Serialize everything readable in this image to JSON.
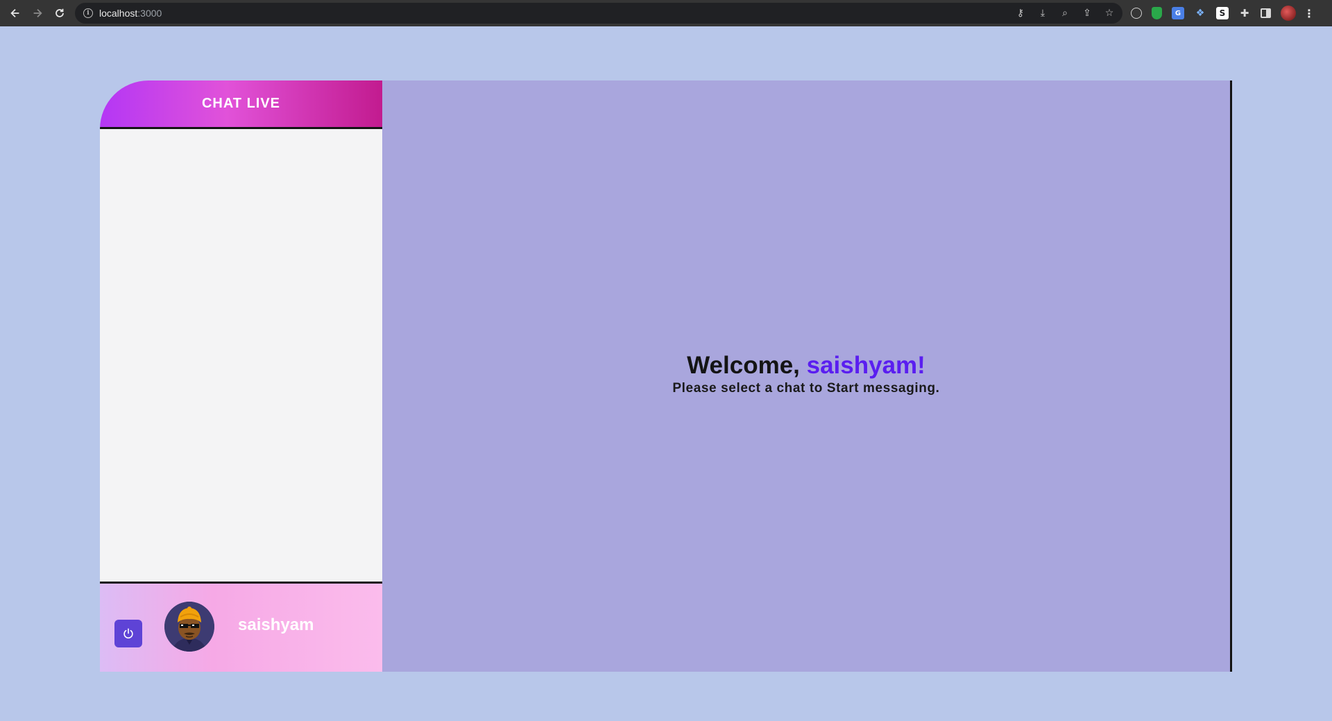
{
  "browser": {
    "url_host": "localhost",
    "url_port": ":3000"
  },
  "sidebar": {
    "title": "CHAT LIVE",
    "chats": []
  },
  "user": {
    "username": "saishyam",
    "avatar_icon": "avatar-icon",
    "logout_icon": "power-icon"
  },
  "main": {
    "welcome_prefix": "Welcome, ",
    "welcome_name": "saishyam!",
    "subtitle": "Please select a chat to Start messaging."
  },
  "colors": {
    "page_background": "#b8c7ea",
    "main_panel": "#a9a6dd",
    "accent_name": "#5a1ef0",
    "logout_button": "#5e43d6",
    "header_gradient_start": "#b437f5",
    "header_gradient_end": "#c21b8f"
  }
}
